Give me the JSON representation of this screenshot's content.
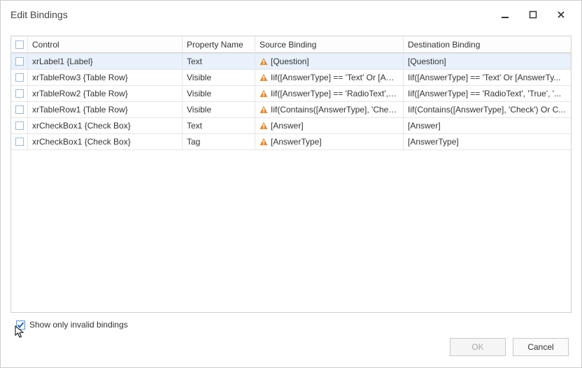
{
  "dialog": {
    "title": "Edit Bindings"
  },
  "columns": {
    "control": "Control",
    "property": "Property Name",
    "source": "Source Binding",
    "destination": "Destination Binding"
  },
  "rows": [
    {
      "selected": true,
      "control": "xrLabel1 {Label}",
      "property": "Text",
      "source": "[Question]",
      "destination": "[Question]",
      "srcWarn": true
    },
    {
      "selected": false,
      "control": "xrTableRow3 {Table Row}",
      "property": "Visible",
      "source": "Iif([AnswerType] == 'Text' Or [Answ...",
      "destination": "Iif([AnswerType] == 'Text' Or [AnswerTy...",
      "srcWarn": true
    },
    {
      "selected": false,
      "control": "xrTableRow2 {Table Row}",
      "property": "Visible",
      "source": "Iif([AnswerType] == 'RadioText', 'Tr...",
      "destination": "Iif([AnswerType] == 'RadioText', 'True', '...",
      "srcWarn": true
    },
    {
      "selected": false,
      "control": "xrTableRow1 {Table Row}",
      "property": "Visible",
      "source": "Iif(Contains([AnswerType], 'Check') ...",
      "destination": "Iif(Contains([AnswerType], 'Check') Or C...",
      "srcWarn": true
    },
    {
      "selected": false,
      "control": "xrCheckBox1 {Check Box}",
      "property": "Text",
      "source": "[Answer]",
      "destination": "[Answer]",
      "srcWarn": true
    },
    {
      "selected": false,
      "control": "xrCheckBox1 {Check Box}",
      "property": "Tag",
      "source": "[AnswerType]",
      "destination": "[AnswerType]",
      "srcWarn": true
    }
  ],
  "footer": {
    "show_only_label": "Show only invalid bindings",
    "show_only_checked": true
  },
  "buttons": {
    "ok": "OK",
    "cancel": "Cancel"
  }
}
